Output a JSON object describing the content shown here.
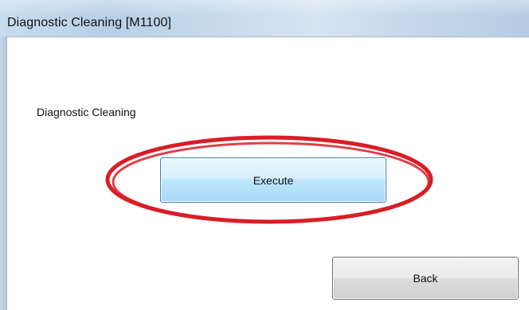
{
  "window": {
    "title": "Diagnostic Cleaning [M1100]"
  },
  "main": {
    "section_label": "Diagnostic Cleaning",
    "execute_label": "Execute",
    "back_label": "Back"
  },
  "colors": {
    "titlebar": "#c9dcef",
    "execute_button": "#bee6fd",
    "execute_border": "#3c7fb1",
    "back_button": "#e5e5e5",
    "annotation_circle": "#d81e27"
  }
}
